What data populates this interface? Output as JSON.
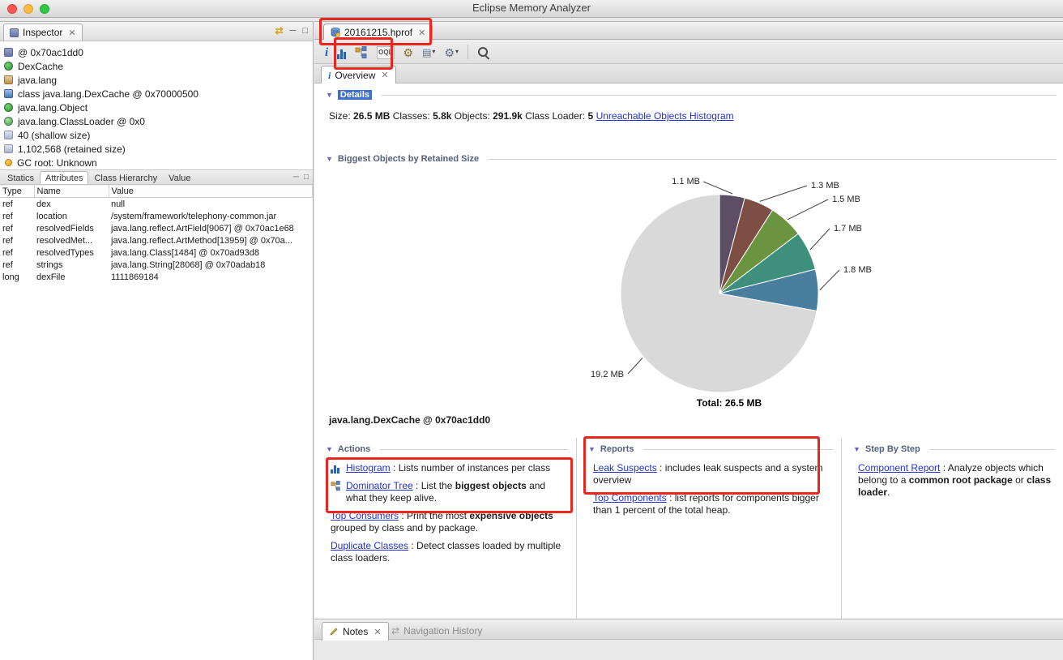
{
  "window": {
    "title": "Eclipse Memory Analyzer"
  },
  "inspector": {
    "title": "Inspector",
    "tree_items": [
      {
        "icon": "object-instance-icon",
        "label": "@ 0x70ac1dd0"
      },
      {
        "icon": "class-green-icon",
        "label": "DexCache"
      },
      {
        "icon": "package-icon",
        "label": "java.lang"
      },
      {
        "icon": "class-blue-icon",
        "label": "class java.lang.DexCache @ 0x70000500"
      },
      {
        "icon": "class-green-icon",
        "label": "java.lang.Object"
      },
      {
        "icon": "classloader-icon",
        "label": "java.lang.ClassLoader @ 0x0"
      },
      {
        "icon": "size-icon",
        "label": "40 (shallow size)"
      },
      {
        "icon": "size-icon",
        "label": "1,102,568 (retained size)"
      },
      {
        "icon": "gc-root-icon",
        "label": "GC root: Unknown"
      }
    ],
    "tabs": [
      {
        "label": "Statics",
        "active": false
      },
      {
        "label": "Attributes",
        "active": true
      },
      {
        "label": "Class Hierarchy",
        "active": false
      },
      {
        "label": "Value",
        "active": false
      }
    ],
    "table": {
      "columns": [
        "Type",
        "Name",
        "Value"
      ],
      "rows": [
        [
          "ref",
          "dex",
          "null"
        ],
        [
          "ref",
          "location",
          "/system/framework/telephony-common.jar"
        ],
        [
          "ref",
          "resolvedFields",
          "java.lang.reflect.ArtField[9067] @ 0x70ac1e68"
        ],
        [
          "ref",
          "resolvedMet...",
          "java.lang.reflect.ArtMethod[13959] @ 0x70a..."
        ],
        [
          "ref",
          "resolvedTypes",
          "java.lang.Class[1484] @ 0x70ad93d8"
        ],
        [
          "ref",
          "strings",
          "java.lang.String[28068] @ 0x70adab18"
        ],
        [
          "long",
          "dexFile",
          "1111869184"
        ]
      ]
    }
  },
  "editor": {
    "file_tab": "20161215.hprof",
    "page_tab": "Overview",
    "toolbar_icons": [
      "overview-info-icon",
      "histogram-icon",
      "dominator-tree-icon",
      "oql-icon",
      "acquire-heap-dump-icon",
      "open-query-browser-icon",
      "configuration-icon",
      "search-icon"
    ]
  },
  "overview": {
    "details_title": "Details",
    "stats": [
      {
        "text": "Size: "
      },
      {
        "text": "26.5 MB",
        "bold": true
      },
      {
        "text": "  Classes: "
      },
      {
        "text": "5.8k",
        "bold": true
      },
      {
        "text": "  Objects: "
      },
      {
        "text": "291.9k",
        "bold": true
      },
      {
        "text": "  Class Loader: "
      },
      {
        "text": "5",
        "bold": true
      },
      {
        "text": "  "
      },
      {
        "text": "Unreachable Objects Histogram",
        "link": true
      }
    ],
    "selected_object": "java.lang.DexCache @ 0x70ac1dd0",
    "sections": {
      "actions": {
        "title": "Actions",
        "items": [
          {
            "icon": "histogram-icon",
            "link": "Histogram",
            "desc": [
              {
                "text": " : Lists number of instances per class"
              }
            ]
          },
          {
            "icon": "dominator-tree-icon",
            "link": "Dominator Tree",
            "desc": [
              {
                "text": " : List the "
              },
              {
                "text": "biggest objects",
                "bold": true
              },
              {
                "text": " and what they keep alive."
              }
            ]
          },
          {
            "link": "Top Consumers",
            "desc": [
              {
                "text": " : Print the most "
              },
              {
                "text": "expensive objects",
                "bold": true
              },
              {
                "text": " grouped by class and by package."
              }
            ]
          },
          {
            "link": "Duplicate Classes",
            "desc": [
              {
                "text": " : Detect classes loaded by multiple class loaders."
              }
            ]
          }
        ]
      },
      "reports": {
        "title": "Reports",
        "items": [
          {
            "link": "Leak Suspects",
            "desc": [
              {
                "text": " : includes leak suspects and a system overview"
              }
            ]
          },
          {
            "link": "Top Components",
            "desc": [
              {
                "text": " : list reports for components bigger than 1 percent of the total heap."
              }
            ]
          }
        ]
      },
      "step_by_step": {
        "title": "Step By Step",
        "items": [
          {
            "link": "Component Report",
            "desc": [
              {
                "text": " : Analyze objects which belong to a "
              },
              {
                "text": "common root package",
                "bold": true
              },
              {
                "text": " or "
              },
              {
                "text": "class loader",
                "bold": true
              },
              {
                "text": "."
              }
            ]
          }
        ]
      }
    }
  },
  "chart_data": {
    "type": "pie",
    "title": "Biggest Objects by Retained Size",
    "total_label": "Total: 26.5 MB",
    "unit": "MB",
    "slices": [
      {
        "label": "1.1 MB",
        "value": 1.1,
        "color": "#5d4e63"
      },
      {
        "label": "1.3 MB",
        "value": 1.3,
        "color": "#7d4f44"
      },
      {
        "label": "1.5 MB",
        "value": 1.5,
        "color": "#6b9440"
      },
      {
        "label": "1.7 MB",
        "value": 1.7,
        "color": "#3f8f7d"
      },
      {
        "label": "1.8 MB",
        "value": 1.8,
        "color": "#497e9e"
      },
      {
        "label": "19.2 MB",
        "value": 19.2,
        "color": "#d9d9d9"
      }
    ],
    "selected_slice_label": "java.lang.DexCache @ 0x70ac1dd0"
  },
  "bottom": {
    "notes_tab": "Notes",
    "nav_history_tab": "Navigation History"
  }
}
